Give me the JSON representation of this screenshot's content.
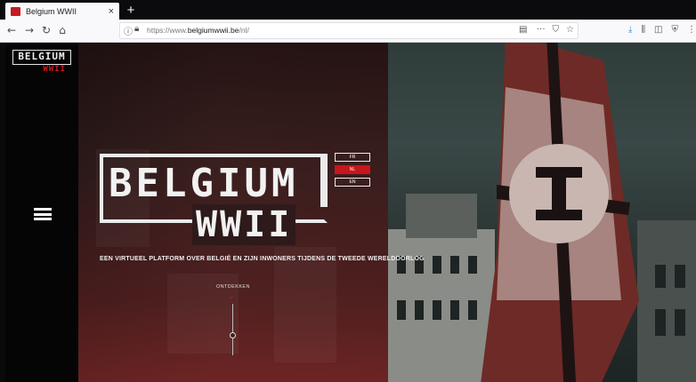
{
  "browser": {
    "tab_title": "Belgium WWII",
    "tab_close": "×",
    "new_tab": "+",
    "url_prefix": "https://www.",
    "url_domain": "belgiumwwii.be",
    "url_path": "/nl/",
    "nav_back": "←",
    "nav_forward": "→",
    "nav_reload": "↻",
    "nav_home": "⌂",
    "url_more": "···",
    "url_pocket": "⛉",
    "url_star": "☆",
    "icons": [
      "back-icon",
      "forward-icon",
      "reload-icon",
      "home-icon",
      "info-icon",
      "lock-icon",
      "reader-icon",
      "more-icon",
      "pocket-icon",
      "star-icon",
      "download-icon",
      "library-icon",
      "sidebar-icon",
      "shield-icon",
      "menu-icon"
    ]
  },
  "sidebar": {
    "logo_text": "BELGIUM",
    "logo_sub": "WWII",
    "menu_icon": "hamburger-icon"
  },
  "hero": {
    "title": "BELGIUM",
    "subtitle": "WWII",
    "tagline": "EEN VIRTUEEL PLATFORM OVER BELGIË EN ZIJN INWONERS TIJDENS DE TWEEDE WERELDOORLOG",
    "languages": [
      "FR",
      "NL",
      "EN"
    ],
    "active_language": "NL",
    "discover_label": "ONTDEKKEN",
    "discover_arrow": "⌄"
  },
  "colors": {
    "accent": "#c8161d",
    "sidebar_bg": "#050505",
    "text": "#f2f2f2"
  }
}
